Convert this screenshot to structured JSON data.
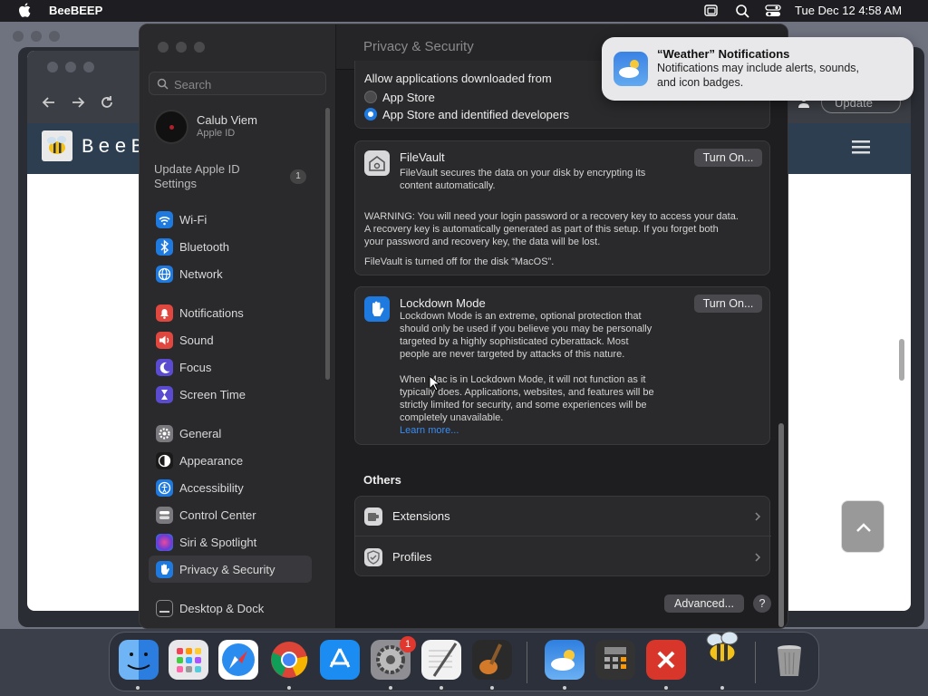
{
  "menubar": {
    "app_name": "BeeBEEP",
    "clock": "Tue Dec 12  4:58 AM"
  },
  "browser": {
    "brand_text": "BeeB",
    "update_label": "Update"
  },
  "settings": {
    "window_title": "Privacy & Security",
    "search_placeholder": "Search",
    "account": {
      "name": "Calub Viem",
      "subtitle": "Apple ID"
    },
    "update_appleid": {
      "label": "Update Apple ID Settings",
      "badge": "1"
    },
    "sidebar": {
      "wifi": "Wi-Fi",
      "bluetooth": "Bluetooth",
      "network": "Network",
      "notifications": "Notifications",
      "sound": "Sound",
      "focus": "Focus",
      "screen_time": "Screen Time",
      "general": "General",
      "appearance": "Appearance",
      "accessibility": "Accessibility",
      "control_center": "Control Center",
      "siri": "Siri & Spotlight",
      "privacy": "Privacy & Security",
      "desktop_dock": "Desktop & Dock"
    },
    "downloads": {
      "heading": "Allow applications downloaded from",
      "option_1": "App Store",
      "option_2": "App Store and identified developers",
      "selected": "App Store and identified developers"
    },
    "filevault": {
      "title": "FileVault",
      "description": "FileVault secures the data on your disk by encrypting its content automatically.",
      "button": "Turn On...",
      "warning_1": "WARNING: You will need your login password or a recovery key to access your data.",
      "warning_2": "A recovery key is automatically generated as part of this setup. If you forget both",
      "warning_3": "your password and recovery key, the data will be lost.",
      "status": "FileVault is turned off for the disk “MacOS”."
    },
    "lockdown": {
      "title": "Lockdown Mode",
      "button": "Turn On...",
      "p1_l1": "Lockdown Mode is an extreme, optional protection that",
      "p1_l2": "should only be used if you believe you may be personally",
      "p1_l3": "targeted by a highly sophisticated cyberattack. Most",
      "p1_l4": "people are never targeted by attacks of this nature.",
      "p2_l1": "When Mac is in Lockdown Mode, it will not function as it",
      "p2_l2": "typically does. Applications, websites, and features will be",
      "p2_l3": "strictly limited for security, and some experiences will be",
      "p2_l4": "completely unavailable.",
      "learn_more": "Learn more..."
    },
    "others": {
      "heading": "Others",
      "extensions": "Extensions",
      "profiles": "Profiles"
    },
    "advanced_button": "Advanced...",
    "help_button": "?"
  },
  "notification": {
    "title": "“Weather” Notifications",
    "body_1": "Notifications may include alerts, sounds,",
    "body_2": "and icon badges."
  },
  "dock": {
    "settings_badge": "1"
  }
}
